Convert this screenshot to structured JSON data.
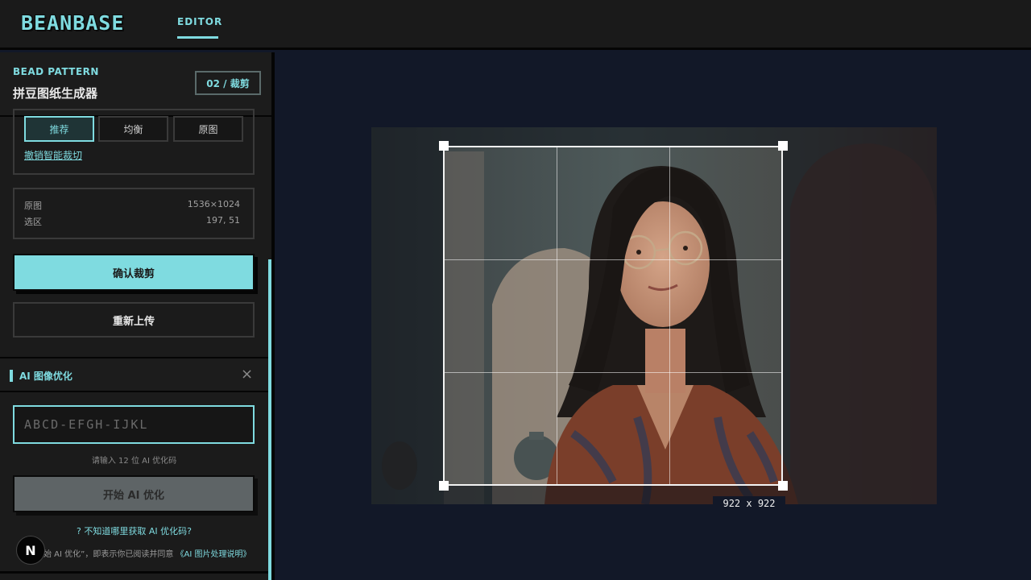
{
  "header": {
    "logo": "BEANBASE",
    "nav_editor": "EDITOR"
  },
  "panel": {
    "label": "BEAD PATTERN",
    "title": "拼豆图纸生成器",
    "step": "02 / 裁剪"
  },
  "crop_modes": [
    "推荐",
    "均衡",
    "原图"
  ],
  "undo_smart_crop": "撤销智能裁切",
  "info": {
    "original_label": "原图",
    "original_value": "1536×1024",
    "selection_label": "选区",
    "selection_value": "197, 51"
  },
  "buttons": {
    "confirm": "确认裁剪",
    "reupload": "重新上传"
  },
  "ai": {
    "title": "AI 图像优化",
    "close": "×",
    "code_placeholder": "ABCD-EFGH-IJKL",
    "hint": "请输入 12 位 AI 优化码",
    "start": "开始 AI 优化",
    "help": "? 不知道哪里获取 AI 优化码?",
    "agree_prefix": "始 AI 优化”，即表示你已阅读并同意",
    "agree_link": "《AI 图片处理说明》"
  },
  "badge": "N",
  "canvas": {
    "crop_size": "922 x 922"
  },
  "colors": {
    "accent": "#7fdbe0",
    "bg": "#121828",
    "panel": "#1b1b1b"
  }
}
